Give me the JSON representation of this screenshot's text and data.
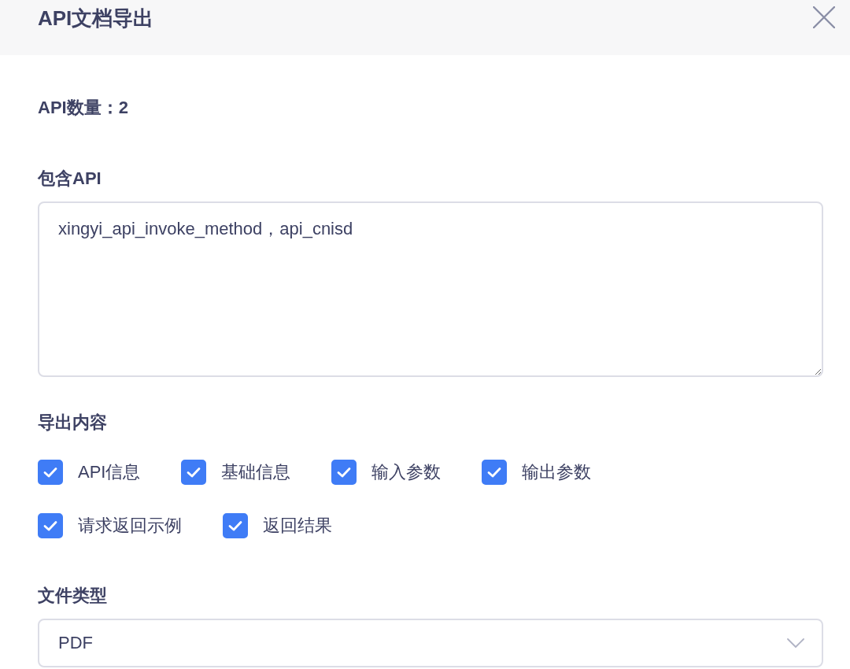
{
  "dialog": {
    "title": "API文档导出"
  },
  "api_count": {
    "text": "API数量：2"
  },
  "included_apis": {
    "label": "包含API",
    "value": "xingyi_api_invoke_method，api_cnisd"
  },
  "export_content": {
    "label": "导出内容",
    "options": [
      {
        "label": "API信息",
        "checked": true
      },
      {
        "label": "基础信息",
        "checked": true
      },
      {
        "label": "输入参数",
        "checked": true
      },
      {
        "label": "输出参数",
        "checked": true
      },
      {
        "label": "请求返回示例",
        "checked": true
      },
      {
        "label": "返回结果",
        "checked": true
      }
    ]
  },
  "file_type": {
    "label": "文件类型",
    "value": "PDF"
  }
}
